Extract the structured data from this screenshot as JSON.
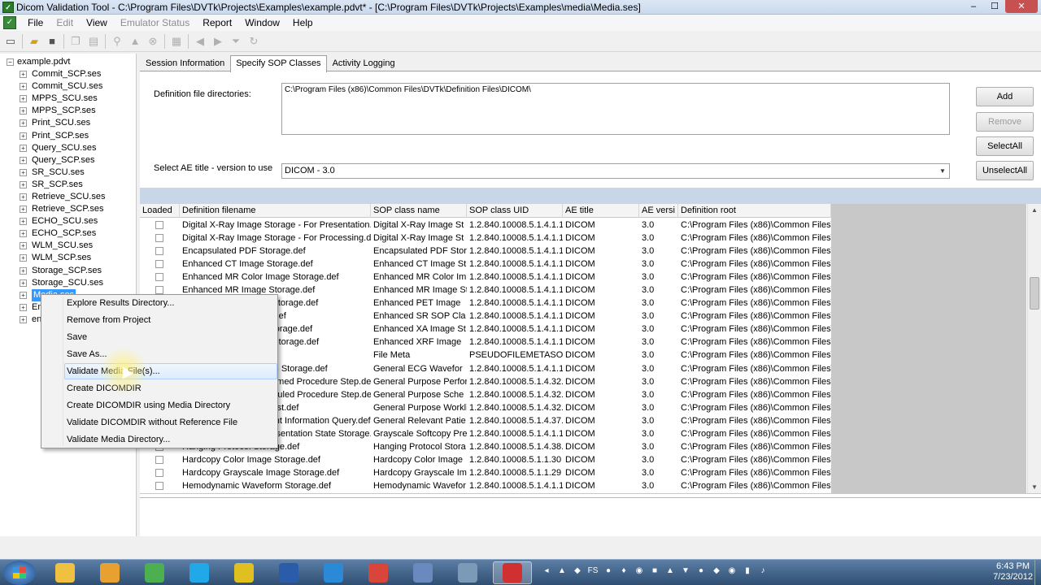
{
  "window": {
    "title": "Dicom Validation Tool - C:\\Program Files\\DVTk\\Projects\\Examples\\example.pdvt* - [C:\\Program Files\\DVTk\\Projects\\Examples\\media\\Media.ses]",
    "min": "–",
    "max": "☐",
    "close": "✕"
  },
  "menu": [
    "File",
    "Edit",
    "View",
    "Emulator Status",
    "Report",
    "Window",
    "Help"
  ],
  "menu_disabled": [
    false,
    true,
    false,
    true,
    false,
    false,
    false
  ],
  "tree": {
    "root": "example.pdvt",
    "items": [
      "Commit_SCP.ses",
      "Commit_SCU.ses",
      "MPPS_SCU.ses",
      "MPPS_SCP.ses",
      "Print_SCU.ses",
      "Print_SCP.ses",
      "Query_SCU.ses",
      "Query_SCP.ses",
      "SR_SCU.ses",
      "SR_SCP.ses",
      "Retrieve_SCU.ses",
      "Retrieve_SCP.ses",
      "ECHO_SCU.ses",
      "ECHO_SCP.ses",
      "WLM_SCU.ses",
      "WLM_SCP.ses",
      "Storage_SCP.ses",
      "Storage_SCU.ses",
      "Media.ses",
      "Em",
      "en"
    ]
  },
  "tabs": [
    "Session Information",
    "Specify SOP Classes",
    "Activity Logging"
  ],
  "definition": {
    "dirs_label": "Definition file directories:",
    "dirs_value": "C:\\Program Files (x86)\\Common Files\\DVTk\\Definition Files\\DICOM\\",
    "ae_label": "Select AE title - version to use",
    "ae_value": "DICOM - 3.0"
  },
  "buttons": {
    "add": "Add",
    "remove": "Remove",
    "select_all": "SelectAll",
    "unselect_all": "UnselectAll"
  },
  "grid": {
    "headers": [
      "Loaded",
      "Definition filename",
      "SOP class name",
      "SOP class UID",
      "AE title",
      "AE versi",
      "Definition root"
    ],
    "rows": [
      [
        "Digital X-Ray Image Storage - For Presentation.",
        "Digital X-Ray Image St",
        "1.2.840.10008.5.1.4.1.1",
        "DICOM",
        "3.0",
        "C:\\Program Files (x86)\\Common Files\\"
      ],
      [
        "Digital X-Ray Image Storage - For Processing.de",
        "Digital X-Ray Image St",
        "1.2.840.10008.5.1.4.1.1",
        "DICOM",
        "3.0",
        "C:\\Program Files (x86)\\Common Files\\"
      ],
      [
        "Encapsulated PDF Storage.def",
        "Encapsulated PDF Stor",
        "1.2.840.10008.5.1.4.1.1",
        "DICOM",
        "3.0",
        "C:\\Program Files (x86)\\Common Files\\"
      ],
      [
        "Enhanced CT Image Storage.def",
        "Enhanced CT Image St",
        "1.2.840.10008.5.1.4.1.1",
        "DICOM",
        "3.0",
        "C:\\Program Files (x86)\\Common Files\\"
      ],
      [
        "Enhanced MR Color Image Storage.def",
        "Enhanced MR Color Im",
        "1.2.840.10008.5.1.4.1.1",
        "DICOM",
        "3.0",
        "C:\\Program Files (x86)\\Common Files\\"
      ],
      [
        "Enhanced MR Image Storage.def",
        "Enhanced MR Image St",
        "1.2.840.10008.5.1.4.1.1",
        "DICOM",
        "3.0",
        "C:\\Program Files (x86)\\Common Files\\"
      ],
      [
        "Enhanced PET Image Storage.def",
        "Enhanced PET Image",
        "1.2.840.10008.5.1.4.1.1",
        "DICOM",
        "3.0",
        "C:\\Program Files (x86)\\Common Files\\"
      ],
      [
        "Enhanced SR Storage.def",
        "Enhanced SR SOP Cla",
        "1.2.840.10008.5.1.4.1.1",
        "DICOM",
        "3.0",
        "C:\\Program Files (x86)\\Common Files\\"
      ],
      [
        "Enhanced XA Image Storage.def",
        "Enhanced XA Image St",
        "1.2.840.10008.5.1.4.1.1",
        "DICOM",
        "3.0",
        "C:\\Program Files (x86)\\Common Files\\"
      ],
      [
        "Enhanced XRF Image Storage.def",
        "Enhanced XRF Image",
        "1.2.840.10008.5.1.4.1.1",
        "DICOM",
        "3.0",
        "C:\\Program Files (x86)\\Common Files\\"
      ],
      [
        "File Meta.def",
        "File Meta",
        "PSEUDOFILEMETASO",
        "DICOM",
        "3.0",
        "C:\\Program Files (x86)\\Common Files\\"
      ],
      [
        "General ECG Waveform Storage.def",
        "General ECG Wavefor",
        "1.2.840.10008.5.1.4.1.1",
        "DICOM",
        "3.0",
        "C:\\Program Files (x86)\\Common Files\\"
      ],
      [
        "General Purpose Performed Procedure Step.def",
        "General Purpose Perfor",
        "1.2.840.10008.5.1.4.32.",
        "DICOM",
        "3.0",
        "C:\\Program Files (x86)\\Common Files\\"
      ],
      [
        "General Purpose Scheduled Procedure Step.def",
        "General Purpose Sche",
        "1.2.840.10008.5.1.4.32.",
        "DICOM",
        "3.0",
        "C:\\Program Files (x86)\\Common Files\\"
      ],
      [
        "General Purpose Worklist.def",
        "General Purpose Workli",
        "1.2.840.10008.5.1.4.32.",
        "DICOM",
        "3.0",
        "C:\\Program Files (x86)\\Common Files\\"
      ],
      [
        "General Relevant Patient Information Query.def",
        "General Relevant Patie",
        "1.2.840.10008.5.1.4.37.",
        "DICOM",
        "3.0",
        "C:\\Program Files (x86)\\Common Files\\"
      ],
      [
        "Grayscale Softcopy Presentation State Storage.",
        "Grayscale Softcopy Pre",
        "1.2.840.10008.5.1.4.1.1",
        "DICOM",
        "3.0",
        "C:\\Program Files (x86)\\Common Files\\"
      ],
      [
        "Hanging Protocol Storage.def",
        "Hanging Protocol Stora",
        "1.2.840.10008.5.1.4.38.",
        "DICOM",
        "3.0",
        "C:\\Program Files (x86)\\Common Files\\"
      ],
      [
        "Hardcopy Color Image Storage.def",
        "Hardcopy Color Image",
        "1.2.840.10008.5.1.1.30",
        "DICOM",
        "3.0",
        "C:\\Program Files (x86)\\Common Files\\"
      ],
      [
        "Hardcopy Grayscale Image Storage.def",
        "Hardcopy Grayscale Im",
        "1.2.840.10008.5.1.1.29",
        "DICOM",
        "3.0",
        "C:\\Program Files (x86)\\Common Files\\"
      ],
      [
        "Hemodynamic Waveform Storage.def",
        "Hemodynamic Wavefor",
        "1.2.840.10008.5.1.4.1.1",
        "DICOM",
        "3.0",
        "C:\\Program Files (x86)\\Common Files\\"
      ]
    ]
  },
  "context_menu": [
    "Explore Results Directory...",
    "Remove from Project",
    "Save",
    "Save As...",
    "Validate Media File(s)...",
    "Create DICOMDIR",
    "Create DICOMDIR using Media Directory",
    "Validate DICOMDIR without Reference File",
    "Validate Media Directory..."
  ],
  "taskbar": {
    "icons": [
      "windows-explorer-icon",
      "outlook-icon",
      "chrome-icon",
      "skype-icon",
      "hardware-icon",
      "word-icon",
      "outlook-express-icon",
      "pdf-icon",
      "network-icon",
      "clock-icon",
      "dvtk-icon"
    ],
    "icon_colors": [
      "#f0c040",
      "#e8a030",
      "#4caf50",
      "#20a8e8",
      "#e0c020",
      "#2a5caa",
      "#2a8ad8",
      "#d8453a",
      "#6a8abf",
      "#7a9ab8",
      "#d03030"
    ],
    "tray": [
      "◂",
      "▲",
      "◆",
      "FS",
      "●",
      "♦",
      "◉",
      "■",
      "▲",
      "▼",
      "●",
      "◆",
      "◉",
      "▮",
      "♪"
    ],
    "time": "6:43 PM",
    "date": "7/23/2012"
  }
}
